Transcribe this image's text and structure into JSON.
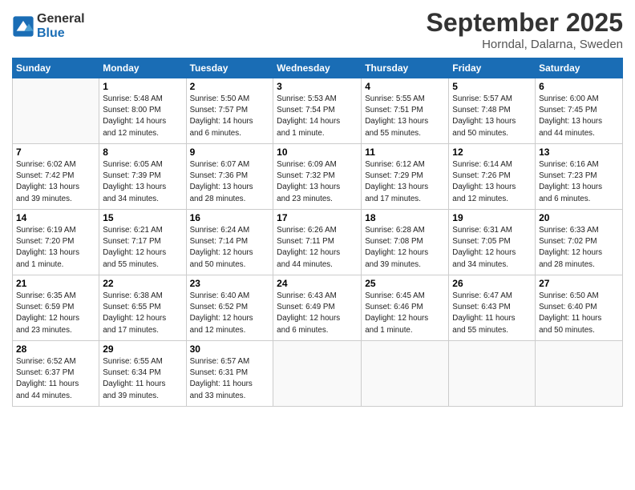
{
  "header": {
    "logo_line1": "General",
    "logo_line2": "Blue",
    "month_title": "September 2025",
    "subtitle": "Horndal, Dalarna, Sweden"
  },
  "days_of_week": [
    "Sunday",
    "Monday",
    "Tuesday",
    "Wednesday",
    "Thursday",
    "Friday",
    "Saturday"
  ],
  "weeks": [
    [
      {
        "day": "",
        "info": ""
      },
      {
        "day": "1",
        "info": "Sunrise: 5:48 AM\nSunset: 8:00 PM\nDaylight: 14 hours\nand 12 minutes."
      },
      {
        "day": "2",
        "info": "Sunrise: 5:50 AM\nSunset: 7:57 PM\nDaylight: 14 hours\nand 6 minutes."
      },
      {
        "day": "3",
        "info": "Sunrise: 5:53 AM\nSunset: 7:54 PM\nDaylight: 14 hours\nand 1 minute."
      },
      {
        "day": "4",
        "info": "Sunrise: 5:55 AM\nSunset: 7:51 PM\nDaylight: 13 hours\nand 55 minutes."
      },
      {
        "day": "5",
        "info": "Sunrise: 5:57 AM\nSunset: 7:48 PM\nDaylight: 13 hours\nand 50 minutes."
      },
      {
        "day": "6",
        "info": "Sunrise: 6:00 AM\nSunset: 7:45 PM\nDaylight: 13 hours\nand 44 minutes."
      }
    ],
    [
      {
        "day": "7",
        "info": "Sunrise: 6:02 AM\nSunset: 7:42 PM\nDaylight: 13 hours\nand 39 minutes."
      },
      {
        "day": "8",
        "info": "Sunrise: 6:05 AM\nSunset: 7:39 PM\nDaylight: 13 hours\nand 34 minutes."
      },
      {
        "day": "9",
        "info": "Sunrise: 6:07 AM\nSunset: 7:36 PM\nDaylight: 13 hours\nand 28 minutes."
      },
      {
        "day": "10",
        "info": "Sunrise: 6:09 AM\nSunset: 7:32 PM\nDaylight: 13 hours\nand 23 minutes."
      },
      {
        "day": "11",
        "info": "Sunrise: 6:12 AM\nSunset: 7:29 PM\nDaylight: 13 hours\nand 17 minutes."
      },
      {
        "day": "12",
        "info": "Sunrise: 6:14 AM\nSunset: 7:26 PM\nDaylight: 13 hours\nand 12 minutes."
      },
      {
        "day": "13",
        "info": "Sunrise: 6:16 AM\nSunset: 7:23 PM\nDaylight: 13 hours\nand 6 minutes."
      }
    ],
    [
      {
        "day": "14",
        "info": "Sunrise: 6:19 AM\nSunset: 7:20 PM\nDaylight: 13 hours\nand 1 minute."
      },
      {
        "day": "15",
        "info": "Sunrise: 6:21 AM\nSunset: 7:17 PM\nDaylight: 12 hours\nand 55 minutes."
      },
      {
        "day": "16",
        "info": "Sunrise: 6:24 AM\nSunset: 7:14 PM\nDaylight: 12 hours\nand 50 minutes."
      },
      {
        "day": "17",
        "info": "Sunrise: 6:26 AM\nSunset: 7:11 PM\nDaylight: 12 hours\nand 44 minutes."
      },
      {
        "day": "18",
        "info": "Sunrise: 6:28 AM\nSunset: 7:08 PM\nDaylight: 12 hours\nand 39 minutes."
      },
      {
        "day": "19",
        "info": "Sunrise: 6:31 AM\nSunset: 7:05 PM\nDaylight: 12 hours\nand 34 minutes."
      },
      {
        "day": "20",
        "info": "Sunrise: 6:33 AM\nSunset: 7:02 PM\nDaylight: 12 hours\nand 28 minutes."
      }
    ],
    [
      {
        "day": "21",
        "info": "Sunrise: 6:35 AM\nSunset: 6:59 PM\nDaylight: 12 hours\nand 23 minutes."
      },
      {
        "day": "22",
        "info": "Sunrise: 6:38 AM\nSunset: 6:55 PM\nDaylight: 12 hours\nand 17 minutes."
      },
      {
        "day": "23",
        "info": "Sunrise: 6:40 AM\nSunset: 6:52 PM\nDaylight: 12 hours\nand 12 minutes."
      },
      {
        "day": "24",
        "info": "Sunrise: 6:43 AM\nSunset: 6:49 PM\nDaylight: 12 hours\nand 6 minutes."
      },
      {
        "day": "25",
        "info": "Sunrise: 6:45 AM\nSunset: 6:46 PM\nDaylight: 12 hours\nand 1 minute."
      },
      {
        "day": "26",
        "info": "Sunrise: 6:47 AM\nSunset: 6:43 PM\nDaylight: 11 hours\nand 55 minutes."
      },
      {
        "day": "27",
        "info": "Sunrise: 6:50 AM\nSunset: 6:40 PM\nDaylight: 11 hours\nand 50 minutes."
      }
    ],
    [
      {
        "day": "28",
        "info": "Sunrise: 6:52 AM\nSunset: 6:37 PM\nDaylight: 11 hours\nand 44 minutes."
      },
      {
        "day": "29",
        "info": "Sunrise: 6:55 AM\nSunset: 6:34 PM\nDaylight: 11 hours\nand 39 minutes."
      },
      {
        "day": "30",
        "info": "Sunrise: 6:57 AM\nSunset: 6:31 PM\nDaylight: 11 hours\nand 33 minutes."
      },
      {
        "day": "",
        "info": ""
      },
      {
        "day": "",
        "info": ""
      },
      {
        "day": "",
        "info": ""
      },
      {
        "day": "",
        "info": ""
      }
    ]
  ]
}
